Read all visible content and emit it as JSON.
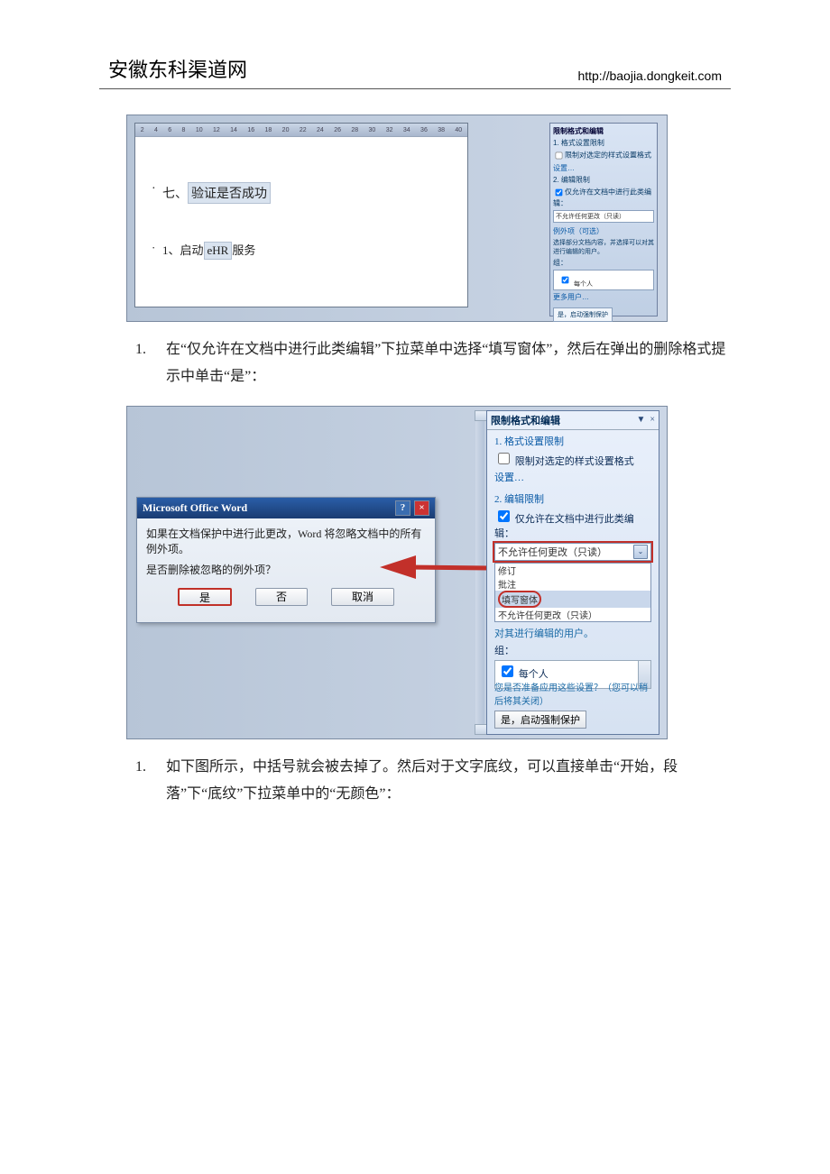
{
  "header": {
    "title": "安徽东科渠道网",
    "url": "http://baojia.dongkeit.com"
  },
  "paragraphs": {
    "p1_marker": "1.",
    "p1_text": "在“仅允许在文档中进行此类编辑”下拉菜单中选择“填写窗体”，然后在弹出的删除格式提示中单击“是”：",
    "p2_marker": "1.",
    "p2_text": "如下图所示，中括号就会被去掉了。然后对于文字底纹，可以直接单击“开始，段落”下“底纹”下拉菜单中的“无颜色”："
  },
  "fig1": {
    "doc_line1_a": "七、",
    "doc_line1_b": "验证是否成功",
    "doc_line2_a": "1、启动",
    "doc_line2_b": "eHR",
    "doc_line2_c": "服务",
    "ruler_nums": [
      "2",
      "4",
      "6",
      "8",
      "10",
      "12",
      "14",
      "16",
      "18",
      "20",
      "22",
      "24",
      "26",
      "28",
      "30",
      "32",
      "34",
      "36",
      "38",
      "40"
    ],
    "pane_title": "限制格式和编辑",
    "pane_s1": "1. 格式设置限制",
    "pane_s1_cb": "限制对选定的样式设置格式",
    "pane_s1_link": "设置…",
    "pane_s2": "2. 编辑限制",
    "pane_s2_cb": "仅允许在文档中进行此类编辑：",
    "pane_dd": "不允许任何更改（只读）",
    "pane_ex": "例外项（可选）",
    "pane_ex_txt": "选择部分文档内容，并选择可以对其进行编辑的用户。",
    "pane_grp": "组：",
    "pane_every": "每个人",
    "pane_more": "更多用户…",
    "pane_btn": "是，启动强制保护"
  },
  "dialog": {
    "title": "Microsoft Office Word",
    "msg1": "如果在文档保护中进行此更改，Word 将忽略文档中的所有例外项。",
    "msg2": "是否删除被忽略的例外项？",
    "yes": "是",
    "no": "否",
    "cancel": "取消"
  },
  "pane": {
    "title": "限制格式和编辑",
    "s1_num": "1. 格式设置限制",
    "s1_cb": "限制对选定的样式设置格式",
    "s1_link": "设置…",
    "s2_num": "2. 编辑限制",
    "s2_cb": "仅允许在文档中进行此类编辑：",
    "dd_sel": "不允许任何更改（只读）",
    "opt_track": "修订",
    "opt_comment": "批注",
    "opt_fill": "填写窗体",
    "opt_ro": "不允许任何更改（只读）",
    "below": "对其进行编辑的用户。",
    "grp": "组：",
    "every": "每个人",
    "apply_q": "您是否准备应用这些设置？（您可以稍后将其关闭）",
    "apply_btn": "是，启动强制保护"
  }
}
